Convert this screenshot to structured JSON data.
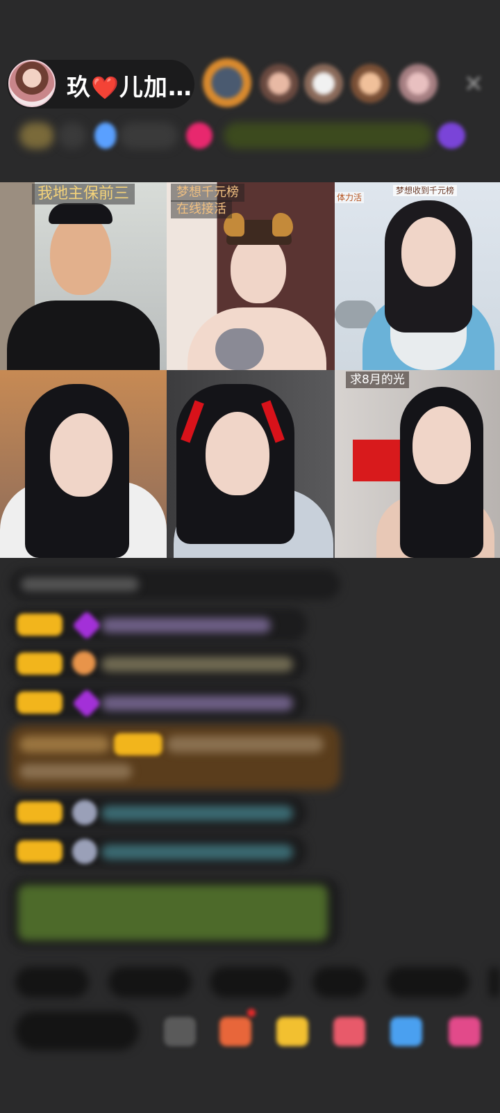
{
  "header": {
    "host_name_left": "玖",
    "host_heart": "❤️",
    "host_name_right": "儿加…",
    "close_glyph": "✕"
  },
  "grid": {
    "tiles": [
      {
        "caption": "我地主保前三"
      },
      {
        "caption_line1": "梦想千元榜",
        "caption_line2": "在线接活"
      },
      {
        "caption_left": "体力活",
        "caption_right": "梦想收到千元榜"
      },
      {
        "caption": ""
      },
      {
        "caption": ""
      },
      {
        "caption": "求8月的光"
      }
    ]
  },
  "colors": {
    "background": "#2a2a2b",
    "badge": "#f2b51c",
    "chat_green": "#8cc63f",
    "chat_purple": "#b77cf0",
    "chat_cyan": "#3aa9b5",
    "highlight_message_bg": "#5a3d1c"
  },
  "icons": [
    "host-avatar",
    "close-icon",
    "diamond-icon",
    "heart-icon",
    "gift-box-icon",
    "gamepad-icon",
    "controller-icon"
  ]
}
